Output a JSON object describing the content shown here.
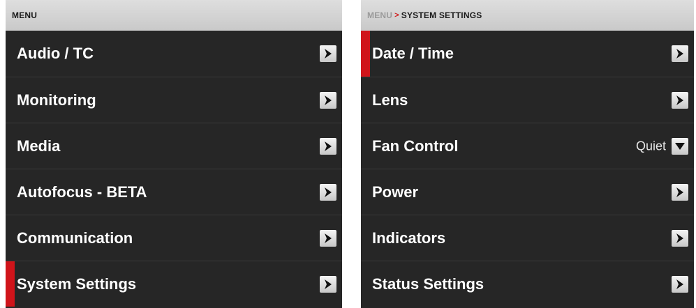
{
  "left_panel": {
    "header": "MENU",
    "items": [
      {
        "label": "Audio / TC",
        "action_icon": "chevron-right-icon"
      },
      {
        "label": "Monitoring",
        "action_icon": "chevron-right-icon"
      },
      {
        "label": "Media",
        "action_icon": "chevron-right-icon"
      },
      {
        "label": "Autofocus - BETA",
        "action_icon": "chevron-right-icon"
      },
      {
        "label": "Communication",
        "action_icon": "chevron-right-icon"
      },
      {
        "label": "System Settings",
        "action_icon": "chevron-right-icon",
        "selected": true
      }
    ]
  },
  "right_panel": {
    "breadcrumb": {
      "root": "MENU",
      "separator": ">",
      "current": "SYSTEM SETTINGS"
    },
    "items": [
      {
        "label": "Date / Time",
        "action_icon": "chevron-right-icon",
        "selected": true
      },
      {
        "label": "Lens",
        "action_icon": "chevron-right-icon"
      },
      {
        "label": "Fan Control",
        "value": "Quiet",
        "action_icon": "chevron-down-icon"
      },
      {
        "label": "Power",
        "action_icon": "chevron-right-icon"
      },
      {
        "label": "Indicators",
        "action_icon": "chevron-right-icon"
      },
      {
        "label": "Status Settings",
        "action_icon": "chevron-right-icon"
      }
    ]
  },
  "colors": {
    "panel_bg": "#262626",
    "header_bg": "#d4d4d4",
    "selection_accent": "#d0141a",
    "text": "#ffffff"
  }
}
